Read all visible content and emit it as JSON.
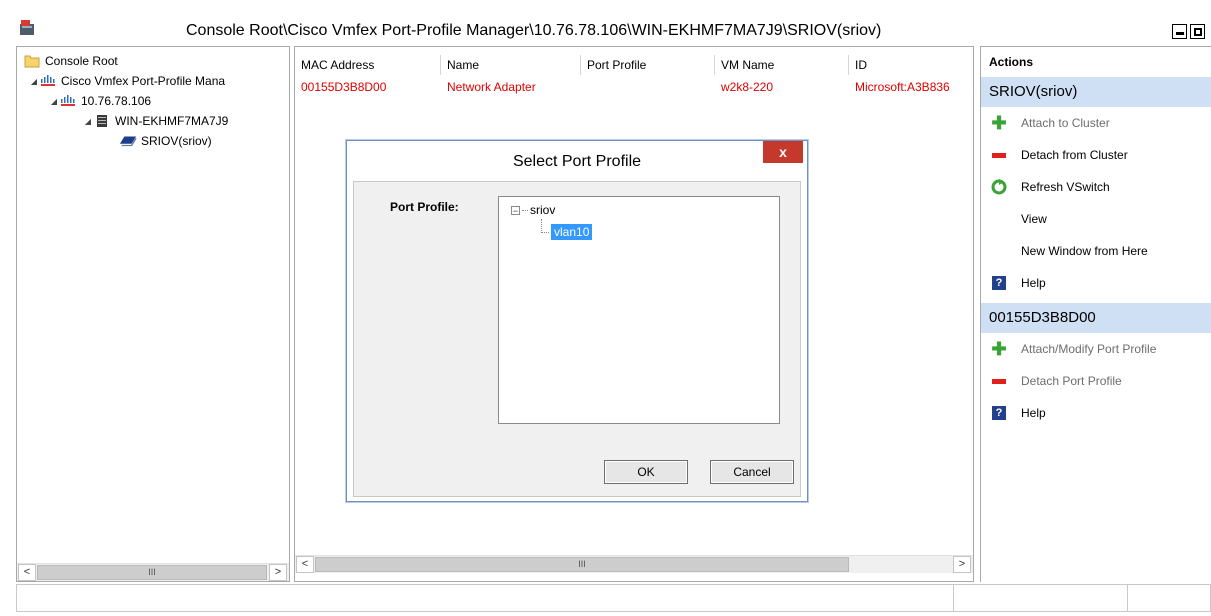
{
  "window": {
    "title": "Console Root\\Cisco Vmfex Port-Profile Manager\\10.76.78.106\\WIN-EKHMF7MA7J9\\SRIOV(sriov)"
  },
  "tree": {
    "items": [
      {
        "label": "Console Root",
        "icon": "folder-icon"
      },
      {
        "label": "Cisco Vmfex Port-Profile Mana",
        "icon": "cisco-logo-icon"
      },
      {
        "label": "10.76.78.106",
        "icon": "cisco-logo-icon"
      },
      {
        "label": "WIN-EKHMF7MA7J9",
        "icon": "server-icon"
      },
      {
        "label": "SRIOV(sriov)",
        "icon": "network-card-icon"
      }
    ],
    "scroll_thumb": "III"
  },
  "list": {
    "columns": [
      "MAC Address",
      "Name",
      "Port Profile",
      "VM Name",
      "ID"
    ],
    "rows": [
      {
        "mac": "00155D3B8D00",
        "name": "Network Adapter",
        "port_profile": "",
        "vm_name": "w2k8-220",
        "id": "Microsoft:A3B836"
      }
    ],
    "row_color": "#e00000",
    "scroll_thumb": "III"
  },
  "actions": {
    "title": "Actions",
    "sections": [
      {
        "header": "SRIOV(sriov)",
        "items": [
          {
            "label": "Attach to Cluster",
            "icon": "plus-icon",
            "enabled": false
          },
          {
            "label": "Detach from Cluster",
            "icon": "minus-icon",
            "enabled": true
          },
          {
            "label": "Refresh VSwitch",
            "icon": "refresh-icon",
            "enabled": true
          },
          {
            "label": "View",
            "icon": "",
            "enabled": true
          },
          {
            "label": "New Window from Here",
            "icon": "",
            "enabled": true
          },
          {
            "label": "Help",
            "icon": "help-icon",
            "enabled": true
          }
        ]
      },
      {
        "header": "00155D3B8D00",
        "items": [
          {
            "label": "Attach/Modify Port Profile",
            "icon": "plus-icon",
            "enabled": false
          },
          {
            "label": "Detach Port Profile",
            "icon": "minus-icon",
            "enabled": false
          },
          {
            "label": "Help",
            "icon": "help-icon",
            "enabled": true
          }
        ]
      }
    ],
    "header_bg": "#cfe0f4"
  },
  "dialog": {
    "title": "Select Port Profile",
    "close_glyph": "x",
    "label": "Port Profile:",
    "tree": {
      "root": "sriov",
      "child": "vlan10",
      "selected_color": "#3399ff"
    },
    "ok_label": "OK",
    "cancel_label": "Cancel"
  }
}
